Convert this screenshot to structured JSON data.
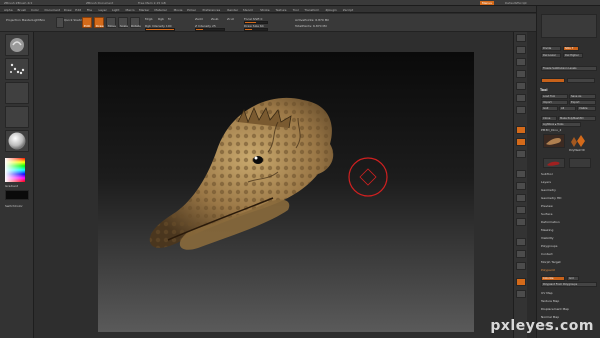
{
  "title_bar": {
    "left": "ZBrush  ZBrush 4r2",
    "mid": "ZBrush Document",
    "right": "Free Mem 2.15 GB",
    "menus_label": "Menus",
    "script_label": "DefaultZScript"
  },
  "menubar": {
    "items": [
      "Alpha",
      "Brush",
      "Color",
      "Document",
      "Draw",
      "Edit",
      "File",
      "Layer",
      "Light",
      "Macro",
      "Marker",
      "Material",
      "Movie",
      "Picker",
      "Preferences",
      "Render",
      "Stencil",
      "Stroke",
      "Texture",
      "Tool",
      "Transform",
      "Zplugin",
      "Zscript"
    ]
  },
  "shelf": {
    "projection_master": "Projection Master",
    "lightbox": "LightBox",
    "quick_sketch": "Quick Sketch",
    "edit": "Edit",
    "draw": "Draw",
    "move": "Move",
    "scale": "Scale",
    "rotate": "Rotate",
    "mrgb": "Mrgb",
    "rgb": "Rgb",
    "m": "M",
    "zadd": "Zadd",
    "zsub": "Zsub",
    "zcut": "Zcut",
    "rgb_intensity": "Rgb Intensity 100",
    "z_intensity": "Z Intensity 25",
    "focal_shift": "Focal Shift 0",
    "draw_size": "Draw Size 64",
    "active_points": "ActivePoints: 6.870 Mil",
    "total_points": "TotalPoints: 6.870 Mil",
    "rgb_intensity_value": 1.0,
    "z_intensity_value": 0.25,
    "focal_shift_value": 0.5,
    "draw_size_value": 0.3
  },
  "leftshelf": {
    "gradient_label": "Gradient",
    "switchcolor_label": "SwitchColor"
  },
  "palette": {
    "divide": "Divide",
    "subdiv": "SDiv 7",
    "del_lower": "Del Lower",
    "del_higher": "Del Higher",
    "freeze_subdiv": "Freeze SubDivision Levels",
    "tool_header": "Tool",
    "load_tool": "Load Tool",
    "save_as": "Save As",
    "import": "Import",
    "export": "Export",
    "goz": "GoZ",
    "all": "All",
    "visible": "Visible",
    "clone": "Clone",
    "make_polymesh": "Make PolyMesh3D",
    "lightbox_tools": "Lightbox ▸ Tools",
    "tool_name": "PM3D_Dino_2",
    "subtool_name": "PolyMesh3D",
    "sections": [
      "SubTool",
      "Layers",
      "Geometry",
      "Geometry HD",
      "Preview",
      "Surface",
      "Deformation",
      "Masking",
      "Visibility",
      "Polygroups",
      "Contact",
      "Morph Target",
      "Polypaint",
      "UV Map",
      "Texture Map",
      "Displacement Map",
      "Normal Map",
      "Import"
    ],
    "polypaint_highlight": "Polypaint",
    "colorize": "Colorize",
    "grd": "Grd",
    "polypaint_from_polygroups": "Polypaint From Polygroups"
  },
  "colors": {
    "accent": "#d46a1a",
    "panel": "#2f2f2f",
    "background": "#2b2b2b"
  },
  "watermark": "pxleyes.com"
}
